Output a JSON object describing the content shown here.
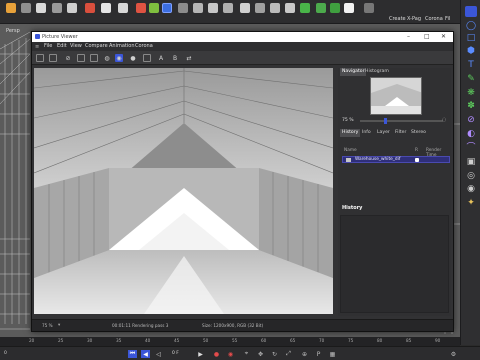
{
  "viewport": {
    "label": "Persp"
  },
  "top_toolbar": {
    "right_labels": [
      "Create",
      "X-Pag",
      "Corona",
      "Fil"
    ]
  },
  "picture_viewer": {
    "title": "Picture Viewer",
    "menu": [
      "File",
      "Edit",
      "View",
      "Compare",
      "Animation",
      "Corona"
    ],
    "toolbar_letters": [
      "A",
      "B"
    ],
    "side_tabs": [
      "Navigator",
      "Histogram"
    ],
    "zoom_value": "75 %",
    "info_tabs": [
      "History",
      "Info",
      "Layer",
      "Filter",
      "Stereo"
    ],
    "history_columns": [
      "Name",
      "R",
      "Render Time"
    ],
    "history_items": [
      {
        "name": "Warehouse_white_dif"
      }
    ],
    "history_section_title": "History",
    "status": {
      "zoom": "75 %",
      "progress": "00:01:11 Rendering pass 3",
      "size": "Size: 1200x900, RGB (32 Bit)"
    }
  },
  "timeline": {
    "ticks": [
      "20",
      "25",
      "30",
      "35",
      "40",
      "45",
      "50",
      "55",
      "60",
      "65",
      "70",
      "75",
      "80",
      "85",
      "90"
    ]
  },
  "bottom_bar": {
    "frame_start": "0",
    "frame_current": "0 F",
    "accent_color": "#3b56d8"
  }
}
